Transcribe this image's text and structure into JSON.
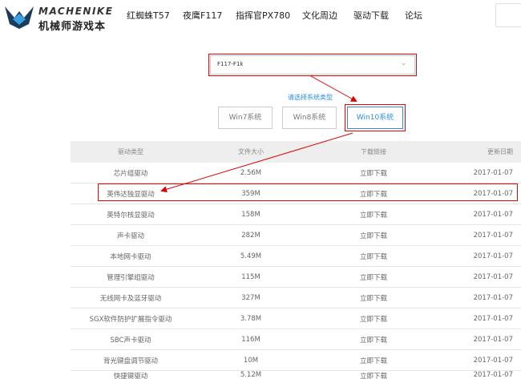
{
  "header": {
    "logo_en": "MACHENIKE",
    "logo_cn": "机械师游戏本",
    "nav": [
      "红蜘蛛T57",
      "夜鹰F117",
      "指挥官PX780",
      "文化周边",
      "驱动下载",
      "论坛"
    ]
  },
  "model_select": {
    "value": "F117-F1k"
  },
  "system_prompt": "请选择系统类型",
  "os_buttons": [
    {
      "label": "Win7系统",
      "active": false
    },
    {
      "label": "Win8系统",
      "active": false
    },
    {
      "label": "Win10系统",
      "active": true
    }
  ],
  "table": {
    "headers": [
      "驱动类型",
      "文件大小",
      "下载链接",
      "更新日期"
    ],
    "rows": [
      {
        "type": "芯片组驱动",
        "size": "2.56M",
        "link": "立即下载",
        "date": "2017-01-07"
      },
      {
        "type": "英伟达独显驱动",
        "size": "359M",
        "link": "立即下载",
        "date": "2017-01-07"
      },
      {
        "type": "英特尔核显驱动",
        "size": "158M",
        "link": "立即下载",
        "date": "2017-01-07"
      },
      {
        "type": "声卡驱动",
        "size": "282M",
        "link": "立即下载",
        "date": "2017-01-07"
      },
      {
        "type": "本地网卡驱动",
        "size": "5.49M",
        "link": "立即下载",
        "date": "2017-01-07"
      },
      {
        "type": "管理引擎组驱动",
        "size": "115M",
        "link": "立即下载",
        "date": "2017-01-07"
      },
      {
        "type": "无线网卡及蓝牙驱动",
        "size": "327M",
        "link": "立即下载",
        "date": "2017-01-07"
      },
      {
        "type": "SGX软件防护扩展指令驱动",
        "size": "3.78M",
        "link": "立即下载",
        "date": "2017-01-07"
      },
      {
        "type": "SBC声卡驱动",
        "size": "116M",
        "link": "立即下载",
        "date": "2017-01-07"
      },
      {
        "type": "背光键盘调节驱动",
        "size": "10M",
        "link": "立即下载",
        "date": "2017-01-07"
      },
      {
        "type": "快捷键驱动",
        "size": "5.12M",
        "link": "立即下载",
        "date": "2017-01-07"
      }
    ]
  },
  "colors": {
    "accent": "#2b8fd8",
    "highlight": "#e00000",
    "header_row": "#eeeeee"
  }
}
